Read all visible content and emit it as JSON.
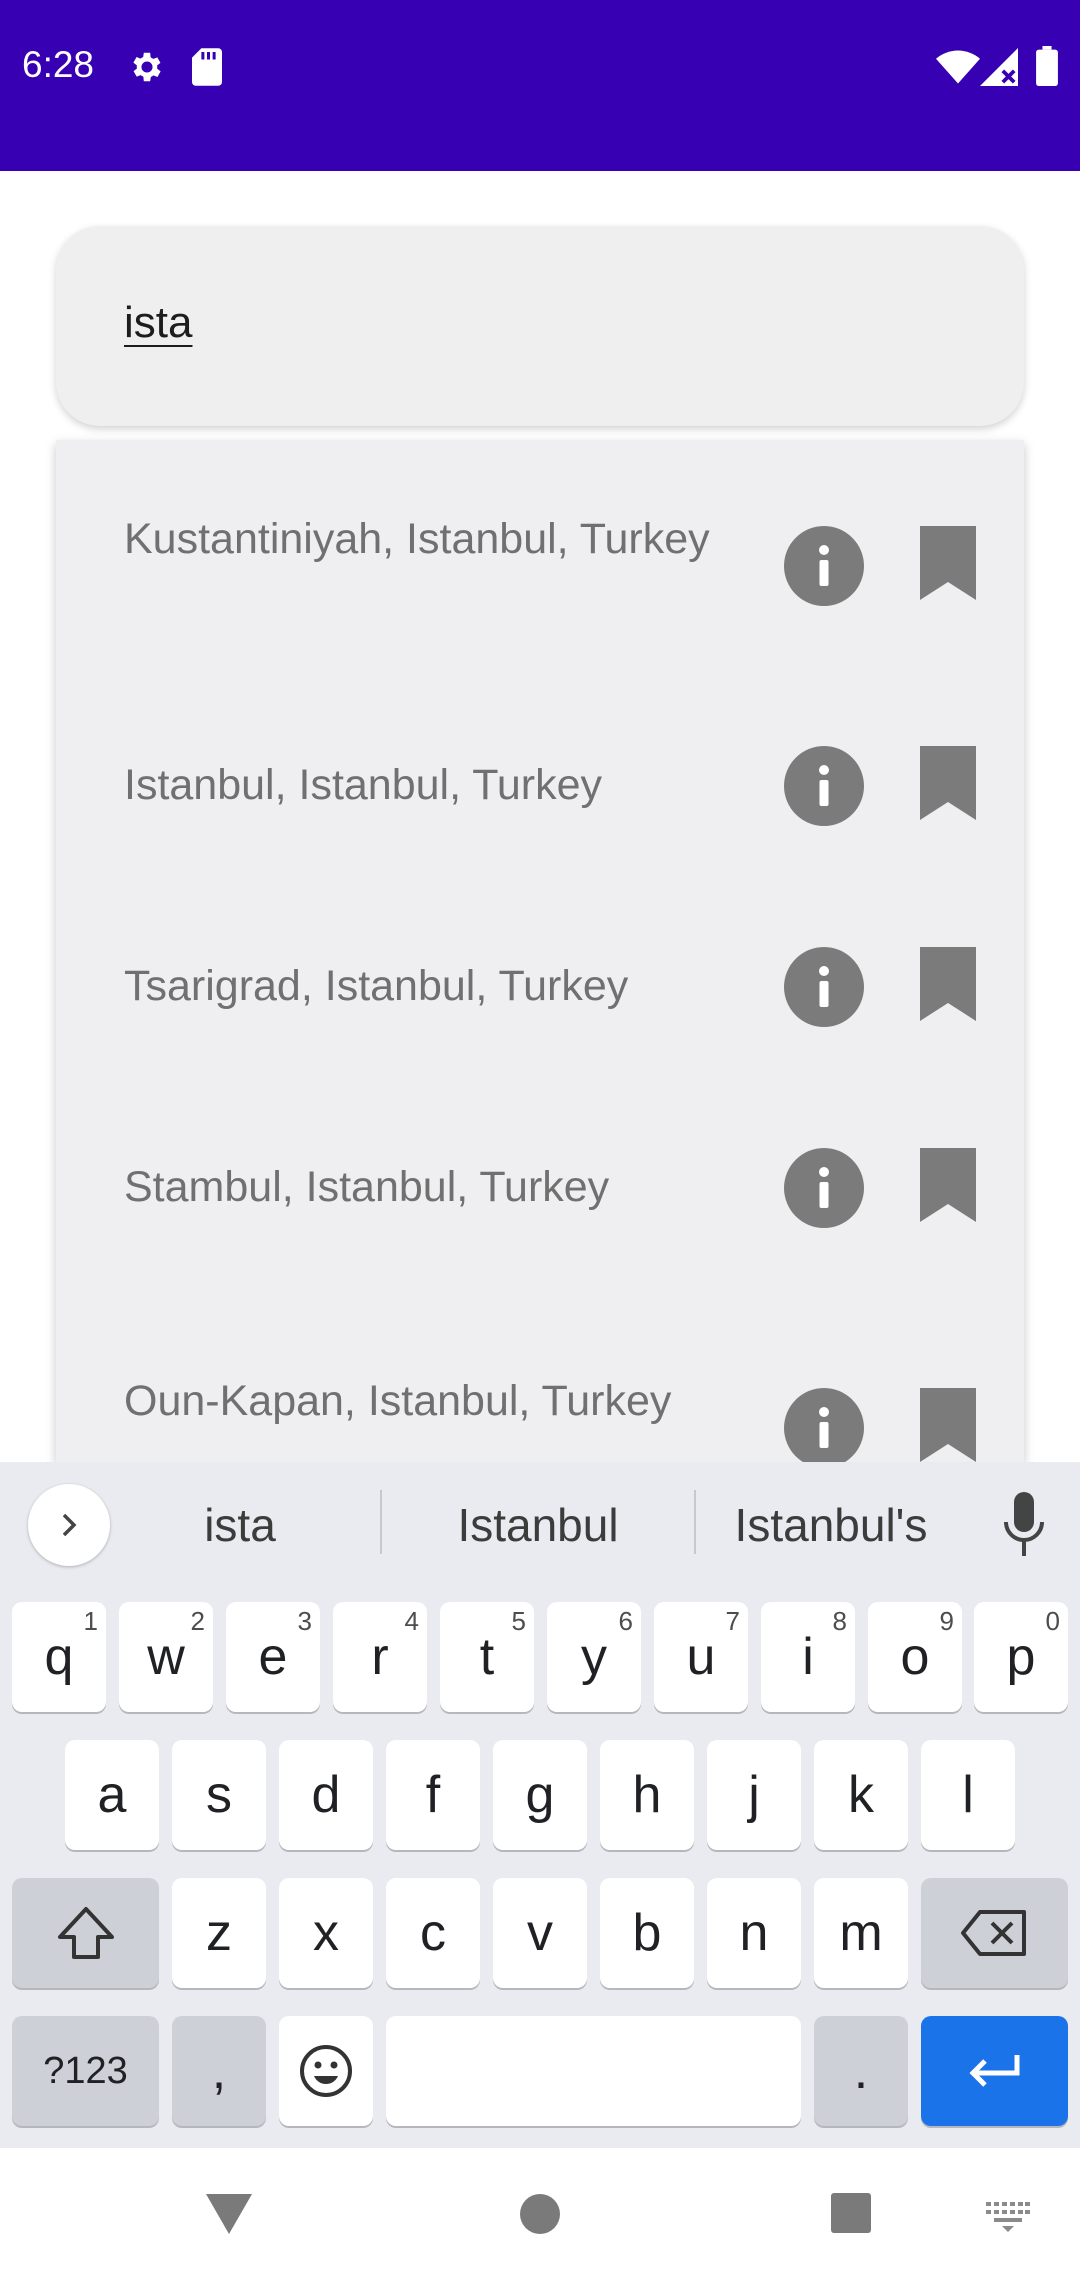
{
  "status_bar": {
    "time": "6:28",
    "left_icons": [
      "gear-icon",
      "sd-card-icon"
    ],
    "right_icons": [
      "wifi-icon",
      "signal-icon",
      "battery-icon"
    ],
    "background": "#3700b3"
  },
  "search": {
    "value": "ista"
  },
  "suggestions": [
    {
      "label": "Kustantiniyah, Istanbul, Turkey"
    },
    {
      "label": "Istanbul, Istanbul, Turkey"
    },
    {
      "label": "Tsarigrad, Istanbul, Turkey"
    },
    {
      "label": "Stambul, Istanbul, Turkey"
    },
    {
      "label": "Oun-Kapan, Istanbul, Turkey"
    }
  ],
  "keyboard": {
    "word_suggestions": [
      "ista",
      "Istanbul",
      "Istanbul's"
    ],
    "row1": [
      {
        "key": "q",
        "hint": "1"
      },
      {
        "key": "w",
        "hint": "2"
      },
      {
        "key": "e",
        "hint": "3"
      },
      {
        "key": "r",
        "hint": "4"
      },
      {
        "key": "t",
        "hint": "5"
      },
      {
        "key": "y",
        "hint": "6"
      },
      {
        "key": "u",
        "hint": "7"
      },
      {
        "key": "i",
        "hint": "8"
      },
      {
        "key": "o",
        "hint": "9"
      },
      {
        "key": "p",
        "hint": "0"
      }
    ],
    "row2": [
      "a",
      "s",
      "d",
      "f",
      "g",
      "h",
      "j",
      "k",
      "l"
    ],
    "row3": [
      "z",
      "x",
      "c",
      "v",
      "b",
      "n",
      "m"
    ],
    "symbols_label": "?123",
    "comma_label": ",",
    "period_label": ".",
    "enter_color": "#1a73e8"
  },
  "nav_bar": {
    "icons": [
      "back-icon",
      "home-icon",
      "recents-icon",
      "keyboard-switch-icon"
    ]
  }
}
